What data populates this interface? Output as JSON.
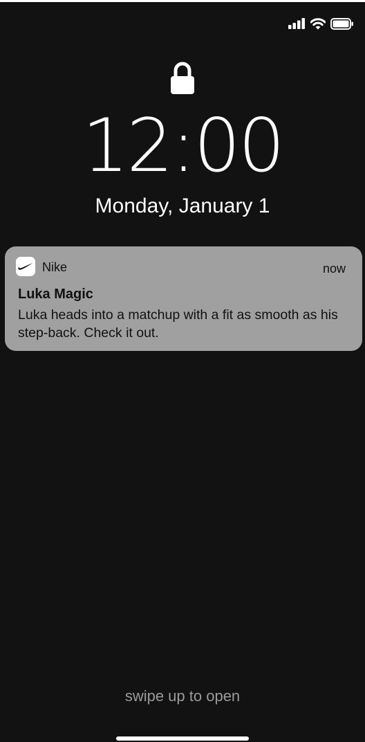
{
  "status_bar": {
    "signal_icon": "cellular-signal-icon",
    "wifi_icon": "wifi-icon",
    "battery_icon": "battery-icon",
    "battery_level": 1.0
  },
  "lock_screen": {
    "lock_icon": "padlock-icon",
    "time": "12:00",
    "date": "Monday, January 1"
  },
  "notification": {
    "app_icon": "nike-swoosh-icon",
    "app_name": "Nike",
    "time": "now",
    "title": "Luka Magic",
    "body": "Luka heads into a matchup with a fit as smooth as his step-back. Check it out."
  },
  "footer": {
    "swipe_hint": "swipe up to open"
  },
  "colors": {
    "background": "#121212",
    "notification_background": "#a0a0a0",
    "text_primary": "#ffffff",
    "notification_text": "#111111",
    "hint_text": "#9a9a9a"
  }
}
